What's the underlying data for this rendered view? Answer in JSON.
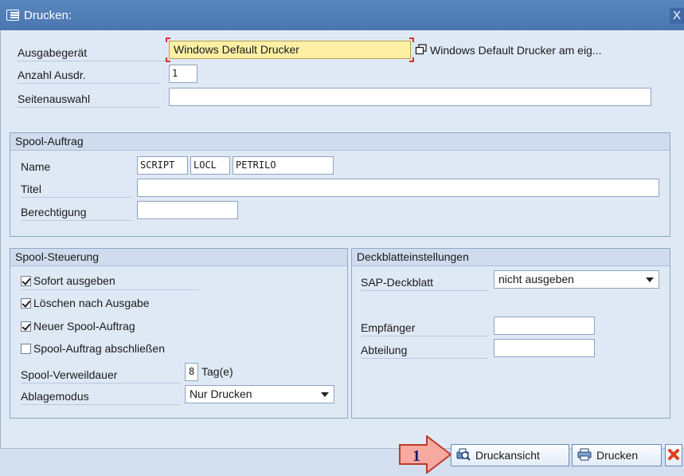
{
  "window": {
    "title": "Drucken:",
    "close_glyph": "X"
  },
  "output": {
    "device_label": "Ausgabegerät",
    "device_value": "Windows Default Drucker",
    "device_desc": "Windows Default Drucker am eig...",
    "copies_label": "Anzahl Ausdr.",
    "copies_value": "1",
    "pages_label": "Seitenauswahl",
    "pages_value": ""
  },
  "spool_request": {
    "title": "Spool-Auftrag",
    "name_label": "Name",
    "name_parts": [
      "SCRIPT",
      "LOCL",
      "PETRILO"
    ],
    "title_label": "Titel",
    "title_value": "",
    "auth_label": "Berechtigung",
    "auth_value": ""
  },
  "spool_control": {
    "title": "Spool-Steuerung",
    "checkboxes": [
      {
        "label": "Sofort ausgeben",
        "checked": true
      },
      {
        "label": "Löschen nach Ausgabe",
        "checked": true
      },
      {
        "label": "Neuer Spool-Auftrag",
        "checked": true
      },
      {
        "label": "Spool-Auftrag abschließen",
        "checked": false
      }
    ],
    "retention_label": "Spool-Verweildauer",
    "retention_value": "8",
    "retention_unit": "Tag(e)",
    "archive_label": "Ablagemodus",
    "archive_value": "Nur Drucken"
  },
  "cover": {
    "title": "Deckblatteinstellungen",
    "sap_cover_label": "SAP-Deckblatt",
    "sap_cover_value": "nicht ausgeben",
    "recipient_label": "Empfänger",
    "recipient_value": "",
    "department_label": "Abteilung",
    "department_value": ""
  },
  "footer": {
    "callout_number": "1",
    "preview_label": "Druckansicht",
    "print_label": "Drucken"
  },
  "colors": {
    "title_bar": "#4a76b0",
    "focus_field": "#fdf0a5",
    "callout_arrow": "#f7a9a0",
    "cancel_icon": "#e0401c"
  },
  "icons": [
    "document-icon",
    "close-icon",
    "f4-help-icon",
    "checkbox-icon",
    "dropdown-arrow-icon",
    "print-preview-icon",
    "printer-icon",
    "cancel-icon",
    "arrow-callout-icon"
  ]
}
